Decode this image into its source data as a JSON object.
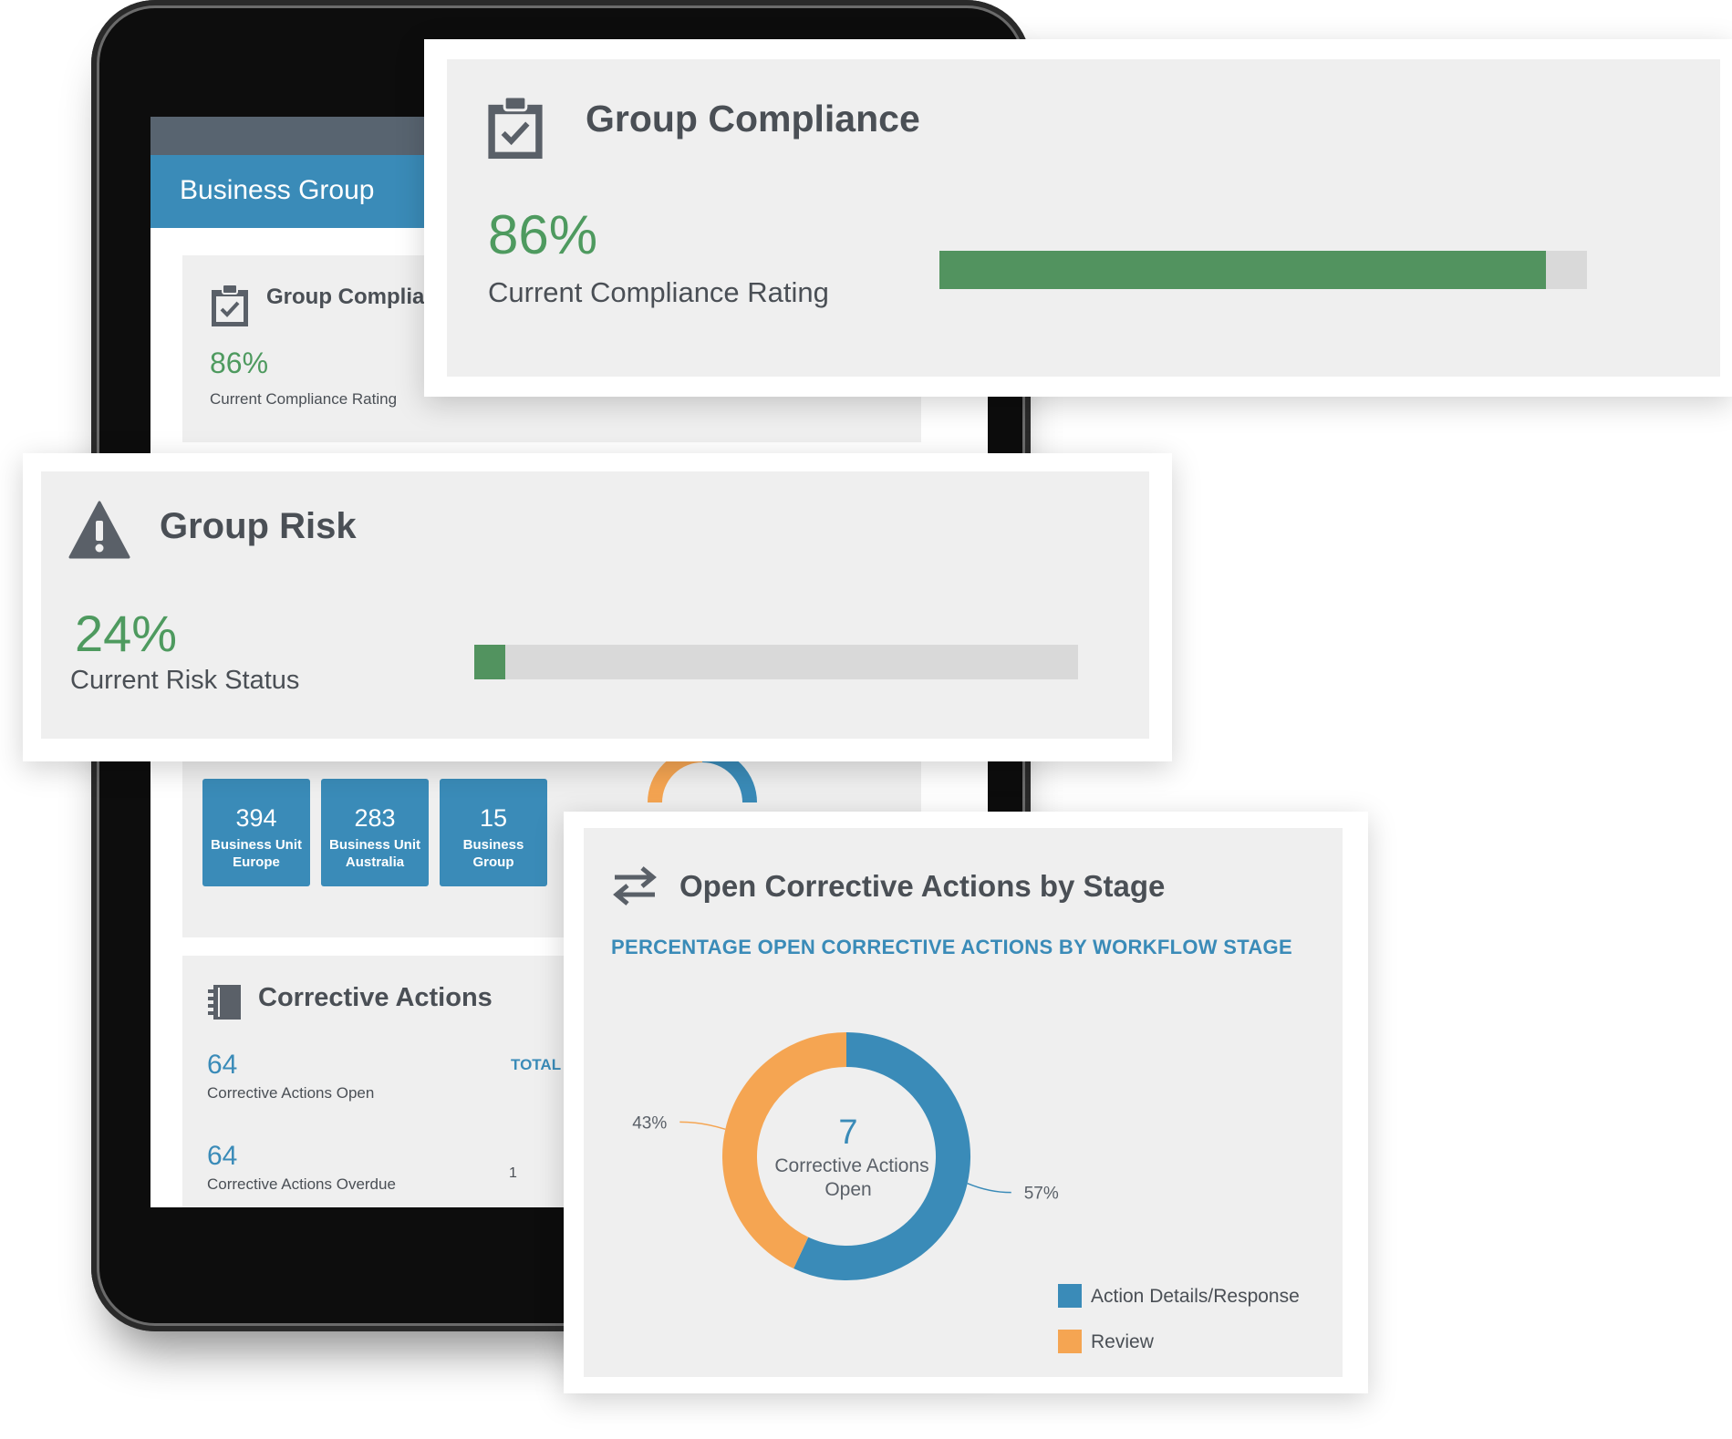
{
  "tablet_screen": {
    "header_title": "Business Group",
    "compliance": {
      "title": "Group Complian",
      "percent": "86%",
      "label": "Current Compliance Rating"
    },
    "business_units": [
      {
        "count": "394",
        "name_line1": "Business Unit",
        "name_line2": "Europe"
      },
      {
        "count": "283",
        "name_line1": "Business Unit",
        "name_line2": "Australia"
      },
      {
        "count": "15",
        "name_line1": "Business",
        "name_line2": "Group"
      }
    ],
    "corrective_actions": {
      "title": "Corrective Actions",
      "open_count": "64",
      "open_label": "Corrective Actions Open",
      "overdue_count": "64",
      "overdue_label": "Corrective Actions Overdue",
      "total_label": "TOTAL",
      "axis_value": "1"
    }
  },
  "group_compliance": {
    "title": "Group Compliance",
    "percent": "86%",
    "label": "Current Compliance Rating",
    "progress": 0.936,
    "bar_color": "#52935f"
  },
  "group_risk": {
    "title": "Group Risk",
    "percent": "24%",
    "label": "Current Risk Status",
    "progress": 0.052,
    "bar_color": "#52935f"
  },
  "open_corrective_actions": {
    "title": "Open Corrective Actions by Stage",
    "subtitle": "PERCENTAGE OPEN CORRECTIVE ACTIONS BY WORKFLOW STAGE",
    "center_value": "7",
    "center_label_line1": "Corrective Actions",
    "center_label_line2": "Open"
  },
  "chart_data": {
    "type": "pie",
    "title": "PERCENTAGE OPEN CORRECTIVE ACTIONS BY WORKFLOW STAGE",
    "categories": [
      "Action Details/Response",
      "Review"
    ],
    "values": [
      57,
      43
    ],
    "data_labels": [
      "57%",
      "43%"
    ],
    "colors": [
      "#3a8bb8",
      "#f5a552"
    ],
    "legend_position": "bottom-right",
    "donut": true
  },
  "colors": {
    "accent_blue": "#3a8bb8",
    "success_green": "#4e9a5f",
    "orange": "#f5a552",
    "card_bg": "#efefef"
  },
  "icons": {
    "compliance": "clipboard-check-icon",
    "risk": "warning-triangle-icon",
    "actions": "arrows-exchange-icon",
    "notebook": "notebook-icon"
  }
}
